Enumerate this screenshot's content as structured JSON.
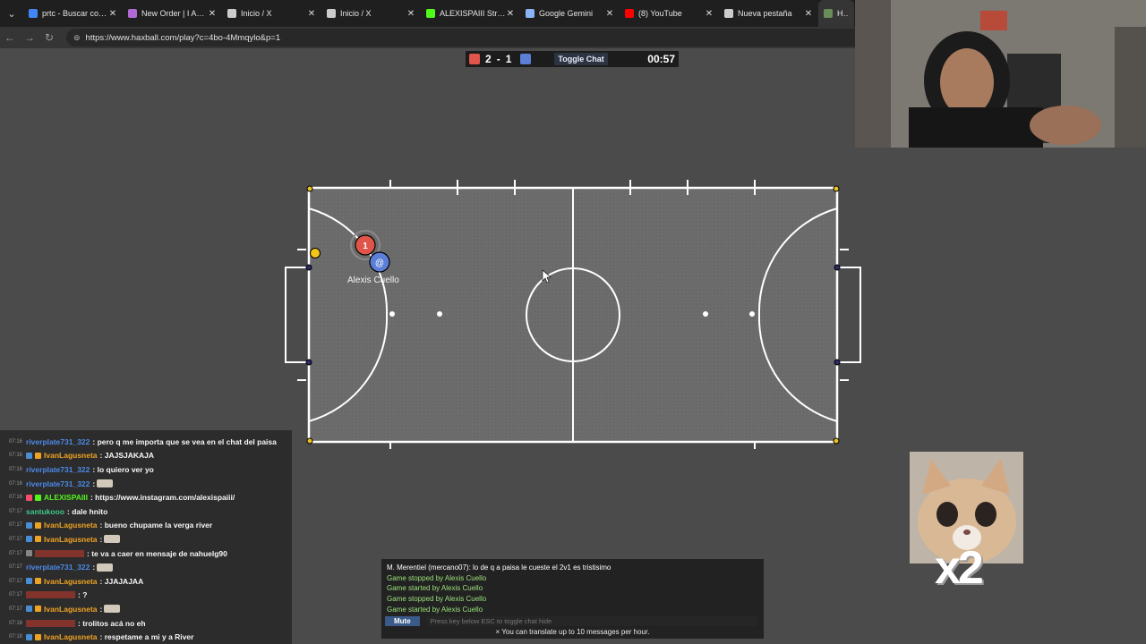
{
  "browser": {
    "tabs": [
      {
        "label": "prtc - Buscar con Go",
        "icon": "google-g-icon",
        "color": "#4285f4"
      },
      {
        "label": "New Order | I Am Pr",
        "icon": "spark-icon",
        "color": "#b06ad6"
      },
      {
        "label": "Inicio / X",
        "icon": "x-logo-icon",
        "color": "#cccccc"
      },
      {
        "label": "Inicio / X",
        "icon": "x-logo-icon",
        "color": "#cccccc"
      },
      {
        "label": "ALEXISPAIII Stream",
        "icon": "kick-logo-icon",
        "color": "#53fc18"
      },
      {
        "label": "Google Gemini",
        "icon": "gemini-icon",
        "color": "#8ab4f8"
      },
      {
        "label": "(8) YouTube",
        "icon": "youtube-icon",
        "color": "#ff0000"
      },
      {
        "label": "Nueva pestaña",
        "icon": "new-tab-icon",
        "color": "#cccccc"
      },
      {
        "label": "Haxb",
        "icon": "haxball-icon",
        "color": "#6a8d5a"
      }
    ],
    "url": "https://www.haxball.com/play?c=4bo-4Mmqylo&p=1"
  },
  "scoreboard": {
    "red_score": "2",
    "separator": "-",
    "blue_score": "1",
    "toggle_chat": "Toggle Chat",
    "time": "00:57",
    "red_color": "#e0554a",
    "blue_color": "#5b7fd6"
  },
  "field": {
    "red_player_number": "1",
    "blue_player_avatar": "@",
    "blue_player_name": "Alexis Cuello"
  },
  "stream_chat": [
    {
      "time": "07:16",
      "user": "riverplate731_322",
      "user_color": "#4d8cf0",
      "badges": [],
      "msg": ": pero q me importa que se vea en el chat del paisa"
    },
    {
      "time": "07:16",
      "user": "IvanLagusneta",
      "user_color": "#f5a623",
      "badges": [
        "#4a90d9",
        "#f5a623"
      ],
      "msg": ": JAJSJAKAJA"
    },
    {
      "time": "07:16",
      "user": "riverplate731_322",
      "user_color": "#4d8cf0",
      "badges": [],
      "msg": ": lo quiero ver yo"
    },
    {
      "time": "07:16",
      "user": "riverplate731_322",
      "user_color": "#4d8cf0",
      "badges": [],
      "msg": ":",
      "emote": true
    },
    {
      "time": "07:16",
      "user": "ALEXISPAIII",
      "user_color": "#53fc18",
      "badges": [
        "#ff4d6d",
        "#53fc18"
      ],
      "msg": ": https://www.instagram.com/alexispaiii/"
    },
    {
      "time": "07:17",
      "user": "santukooo",
      "user_color": "#3ecf8e",
      "badges": [],
      "msg": ": dale hnito"
    },
    {
      "time": "07:17",
      "user": "IvanLagusneta",
      "user_color": "#f5a623",
      "badges": [
        "#4a90d9",
        "#f5a623"
      ],
      "msg": ": bueno chupame la verga river"
    },
    {
      "time": "07:17",
      "user": "IvanLagusneta",
      "user_color": "#f5a623",
      "badges": [
        "#4a90d9",
        "#f5a623"
      ],
      "msg": ":",
      "emote": true
    },
    {
      "time": "07:17",
      "user": "",
      "user_color": "#c0392b",
      "badges": [
        "#888888"
      ],
      "msg": ": te va a caer en mensaje de nahuelg90"
    },
    {
      "time": "07:17",
      "user": "riverplate731_322",
      "user_color": "#4d8cf0",
      "badges": [],
      "msg": ":",
      "emote": true
    },
    {
      "time": "07:17",
      "user": "IvanLagusneta",
      "user_color": "#f5a623",
      "badges": [
        "#4a90d9",
        "#f5a623"
      ],
      "msg": ": JJAJAJAA"
    },
    {
      "time": "07:17",
      "user": "",
      "user_color": "#c0392b",
      "badges": [],
      "msg": ": ?"
    },
    {
      "time": "07:17",
      "user": "IvanLagusneta",
      "user_color": "#f5a623",
      "badges": [
        "#4a90d9",
        "#f5a623"
      ],
      "msg": ":",
      "emote": true
    },
    {
      "time": "07:18",
      "user": "",
      "user_color": "#c0392b",
      "badges": [],
      "msg": ": trolitos acá no eh"
    },
    {
      "time": "07:18",
      "user": "IvanLagusneta",
      "user_color": "#f5a623",
      "badges": [
        "#4a90d9",
        "#f5a623"
      ],
      "msg": ": respetame a mi y a River"
    }
  ],
  "sticker": {
    "text": "x2"
  },
  "game_chat": {
    "lines": [
      {
        "text": "M. Merentiel (mercano07): lo de q a paisa le cueste el 2v1 es tristisimo",
        "color": "white"
      },
      {
        "text": "Game stopped by Alexis Cuello",
        "color": "green"
      },
      {
        "text": "Game started by Alexis Cuello",
        "color": "green"
      },
      {
        "text": "Game stopped by Alexis Cuello",
        "color": "green"
      },
      {
        "text": "Game started by Alexis Cuello",
        "color": "green"
      }
    ],
    "mute_label": "Mute",
    "input_placeholder": "Press key below ESC to toggle chat hide",
    "translate_note": "× You can translate up to 10 messages per hour."
  }
}
